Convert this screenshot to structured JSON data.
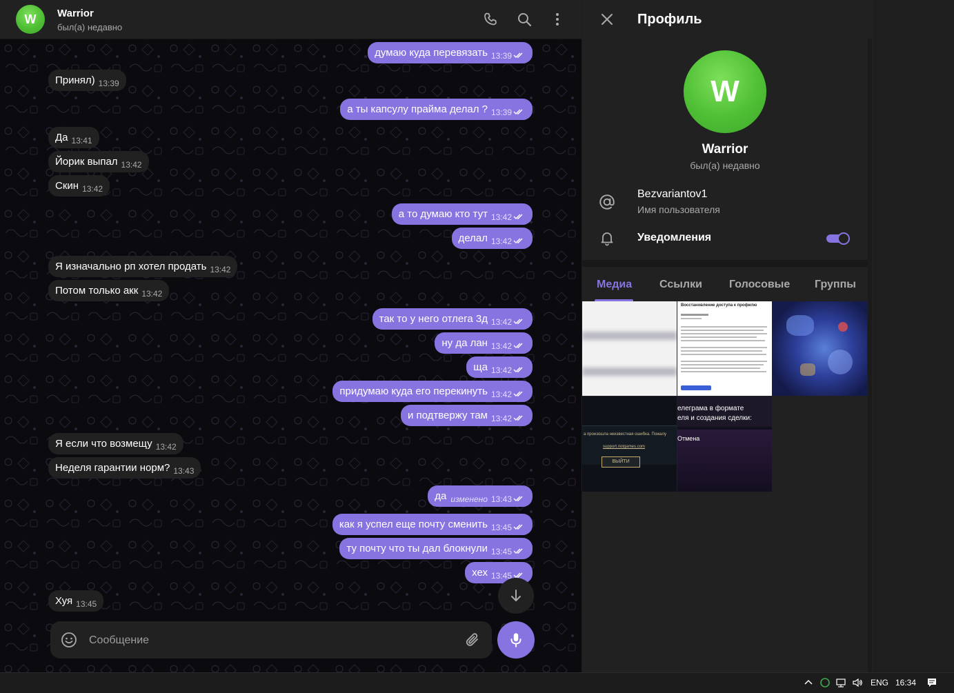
{
  "chat_header": {
    "avatar_letter": "W",
    "name": "Warrior",
    "status": "был(а) недавно"
  },
  "messages": [
    {
      "dir": "out",
      "text": "думаю куда перевязать",
      "time": "13:39"
    },
    {
      "dir": "in",
      "text": "Принял)",
      "time": "13:39"
    },
    {
      "dir": "out",
      "text": "а ты капсулу прайма делал ?",
      "time": "13:39"
    },
    {
      "dir": "in",
      "text": "Да",
      "time": "13:41"
    },
    {
      "dir": "in",
      "text": "Йорик выпал",
      "time": "13:42"
    },
    {
      "dir": "in",
      "text": "Скин",
      "time": "13:42"
    },
    {
      "dir": "out",
      "text": "а то думаю кто тут",
      "time": "13:42"
    },
    {
      "dir": "out",
      "text": "делал",
      "time": "13:42"
    },
    {
      "dir": "in",
      "text": "Я изначально рп хотел продать",
      "time": "13:42"
    },
    {
      "dir": "in",
      "text": "Потом только акк",
      "time": "13:42"
    },
    {
      "dir": "out",
      "text": "так то у него отлега 3д",
      "time": "13:42"
    },
    {
      "dir": "out",
      "text": "ну да лан",
      "time": "13:42"
    },
    {
      "dir": "out",
      "text": "ща",
      "time": "13:42"
    },
    {
      "dir": "out",
      "text": "придумаю куда его перекинуть",
      "time": "13:42"
    },
    {
      "dir": "out",
      "text": "и подтвержу там",
      "time": "13:42"
    },
    {
      "dir": "in",
      "text": "Я если что возмещу",
      "time": "13:42"
    },
    {
      "dir": "in",
      "text": "Неделя гарантии норм?",
      "time": "13:43"
    },
    {
      "dir": "out",
      "text": "да",
      "time": "13:43",
      "edited": "изменено"
    },
    {
      "dir": "out",
      "text": "как я успел еще почту сменить",
      "time": "13:45"
    },
    {
      "dir": "out",
      "text": "ту почту что ты дал блокнули",
      "time": "13:45"
    },
    {
      "dir": "out",
      "text": "хех",
      "time": "13:45"
    },
    {
      "dir": "in",
      "text": "Хуя",
      "time": "13:45"
    }
  ],
  "composer": {
    "placeholder": "Сообщение"
  },
  "profile": {
    "title": "Профиль",
    "avatar_letter": "W",
    "name": "Warrior",
    "status": "был(а) недавно",
    "username": "Bezvariantov1",
    "username_label": "Имя пользователя",
    "notifications_label": "Уведомления",
    "notifications_on": true,
    "tabs": [
      {
        "label": "Медиа",
        "active": true
      },
      {
        "label": "Ссылки",
        "active": false
      },
      {
        "label": "Голосовые",
        "active": false
      },
      {
        "label": "Группы",
        "active": false
      }
    ],
    "media": {
      "thumb2_heading": "Восстановление доступа к профилю",
      "thumb5_line1": "елеграма в формате",
      "thumb5_line2": "еля и создания сделки:",
      "thumb4_text": "а произошла неизвестная ошибка. Пожалу",
      "thumb4_link": "support.riotgames.com",
      "thumb4_button": "выйти",
      "thumb6_text": "Отмена"
    }
  },
  "taskbar": {
    "lang": "ENG",
    "time": "16:34"
  },
  "colors": {
    "accent": "#8774e1",
    "avatar_green": "#4fbf35",
    "panel": "#212121",
    "chat_bg": "#0b0a0e"
  }
}
